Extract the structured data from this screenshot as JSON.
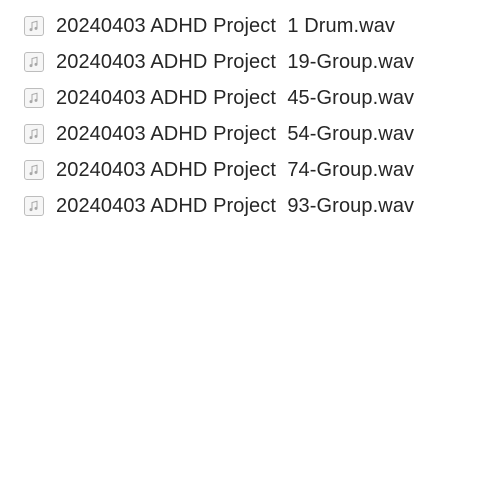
{
  "files": [
    {
      "name": "20240403 ADHD Project  1 Drum.wav",
      "icon": "audio-file-icon"
    },
    {
      "name": "20240403 ADHD Project  19-Group.wav",
      "icon": "audio-file-icon"
    },
    {
      "name": "20240403 ADHD Project  45-Group.wav",
      "icon": "audio-file-icon"
    },
    {
      "name": "20240403 ADHD Project  54-Group.wav",
      "icon": "audio-file-icon"
    },
    {
      "name": "20240403 ADHD Project  74-Group.wav",
      "icon": "audio-file-icon"
    },
    {
      "name": "20240403 ADHD Project  93-Group.wav",
      "icon": "audio-file-icon"
    }
  ]
}
